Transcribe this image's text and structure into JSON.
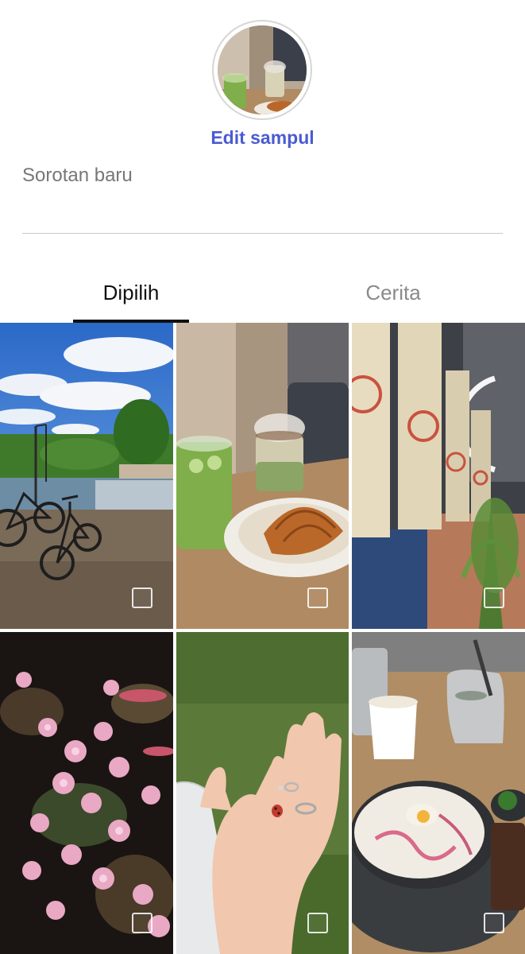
{
  "cover": {
    "edit_label": "Edit sampul",
    "image_icon": "cover-photo-matcha-croissant"
  },
  "highlight_name": {
    "placeholder": "Sorotan baru",
    "value": ""
  },
  "tabs": [
    {
      "label": "Dipilih",
      "selected": true
    },
    {
      "label": "Cerita",
      "selected": false
    }
  ],
  "grid": {
    "items": [
      {
        "photo": "river-bicycles",
        "checked": false
      },
      {
        "photo": "matcha-croissant",
        "checked": false
      },
      {
        "photo": "restaurant-curtains",
        "checked": false
      },
      {
        "photo": "pink-blossoms",
        "checked": false
      },
      {
        "photo": "hand-ladybug",
        "checked": false
      },
      {
        "photo": "soup-coffee",
        "checked": false
      }
    ]
  },
  "colors": {
    "accent": "#4a5bd1",
    "tab_selected": "#111111",
    "tab_unselected": "#8a8a8a",
    "divider": "#c8c8c8"
  }
}
